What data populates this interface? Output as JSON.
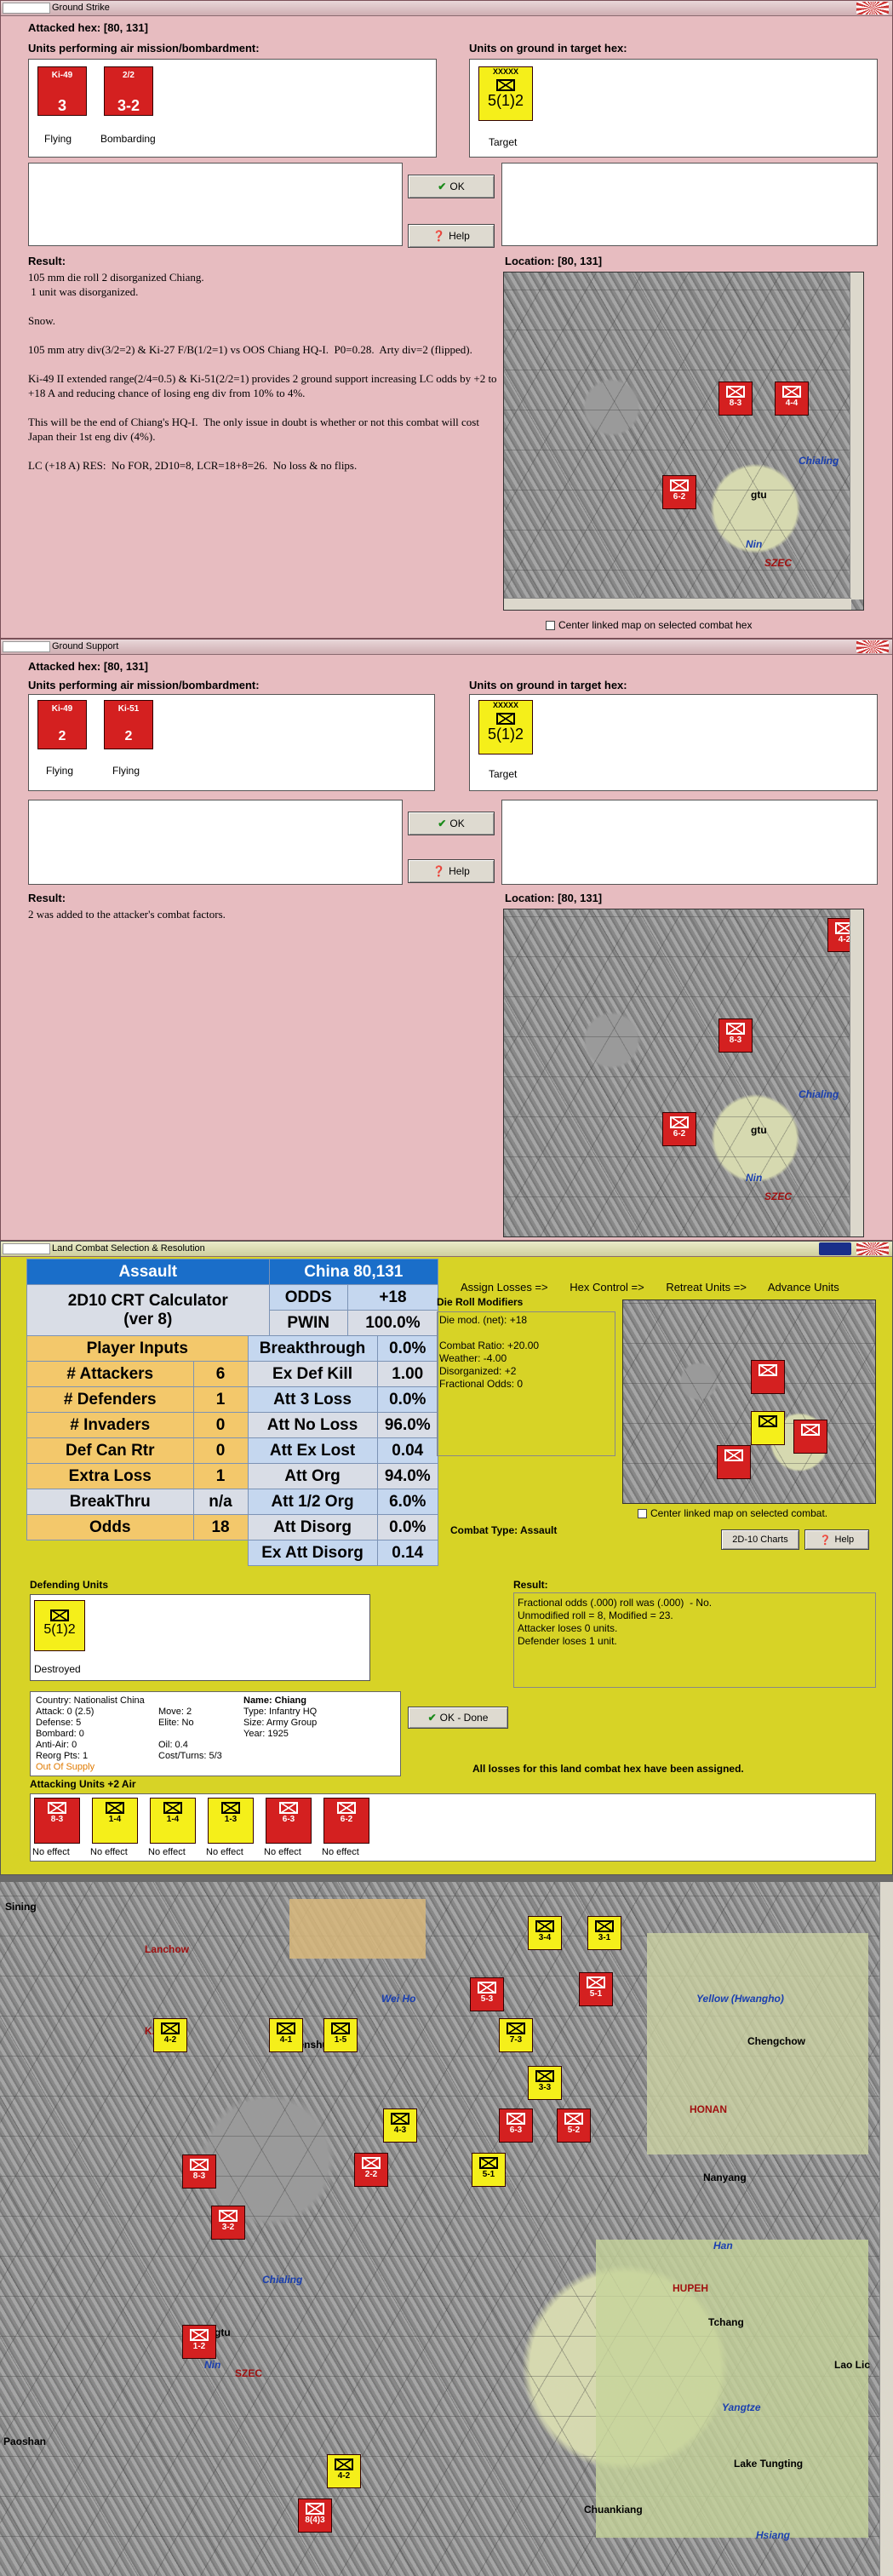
{
  "ground_strike": {
    "title": "Ground Strike",
    "attacked_hex": "Attacked hex:  [80, 131]",
    "units_air_label": "Units performing air mission/bombardment:",
    "units_ground_label": "Units on ground in target hex:",
    "air_units": [
      {
        "name": "Ki-49",
        "value": "3",
        "caption": "Flying"
      },
      {
        "name": "2/2",
        "value": "3-2",
        "caption": "Bombarding"
      }
    ],
    "target_unit": {
      "type": "XXXXX",
      "nation": "Chiang",
      "value": "5(1)2",
      "caption": "Target"
    },
    "ok_label": "OK",
    "help_label": "Help",
    "result_label": "Result:",
    "location_label": "Location:  [80, 131]",
    "result_text": "105 mm die roll 2 disorganized Chiang.\n 1 unit was disorganized.\n\nSnow.\n\n105 mm atry div(3/2=2) & Ki-27 F/B(1/2=1) vs OOS Chiang HQ-I.  P0=0.28.  Arty div=2 (flipped).\n\nKi-49 II extended range(2/4=0.5) & Ki-51(2/2=1) provides 2 ground support increasing LC odds by +2 to +18 A and reducing chance of losing eng div from 10% to 4%.\n\nThis will be the end of Chiang's HQ-I.  The only issue in doubt is whether or not this combat will cost Japan their 1st eng div (4%).\n\nLC (+18 A) RES:  No FOR, 2D10=8, LCR=18+8=26.  No loss & no flips.",
    "center_map_label": "Center linked map on selected combat hex",
    "map_labels": [
      "Chialing",
      "Nin",
      "SZEC",
      "gtu"
    ],
    "map_units": [
      "8-3",
      "4-4",
      "6-2"
    ]
  },
  "ground_support": {
    "title": "Ground Support",
    "attacked_hex": "Attacked hex:  [80, 131]",
    "units_air_label": "Units performing air mission/bombardment:",
    "units_ground_label": "Units on ground in target hex:",
    "air_units": [
      {
        "name": "Ki-49",
        "value": "2",
        "caption": "Flying"
      },
      {
        "name": "Ki-51",
        "value": "2",
        "caption": "Flying"
      }
    ],
    "target_unit": {
      "type": "XXXXX",
      "nation": "Chiang",
      "value": "5(1)2",
      "caption": "Target"
    },
    "ok_label": "OK",
    "help_label": "Help",
    "result_label": "Result:",
    "location_label": "Location:  [80, 131]",
    "result_text": "2 was added to the attacker's combat factors.",
    "map_labels": [
      "Chialing",
      "Nin",
      "SZEC",
      "gtu"
    ],
    "map_units": [
      "8-3",
      "6-2",
      "4-2"
    ]
  },
  "land_combat": {
    "title": "Land Combat Selection & Resolution",
    "tabs": [
      "Assign Losses =>",
      "Hex Control =>",
      "Retreat Units =>",
      "Advance Units"
    ],
    "crt": {
      "assault": "Assault",
      "location": "China 80,131",
      "calc_title": "2D10 CRT Calculator",
      "version": "(ver 8)",
      "player_inputs": "Player Inputs",
      "rows": [
        {
          "label": "# Attackers",
          "value": "6",
          "stat": "Ex Def Kill",
          "pct": "1.00"
        },
        {
          "label": "# Defenders",
          "value": "1",
          "stat": "Att 3 Loss",
          "pct": "0.0%"
        },
        {
          "label": "# Invaders",
          "value": "0",
          "stat": "Att No Loss",
          "pct": "96.0%"
        },
        {
          "label": "Def Can Rtr",
          "value": "0",
          "stat": "Att Ex Lost",
          "pct": "0.04"
        },
        {
          "label": "Extra Loss",
          "value": "1",
          "stat": "Att Org",
          "pct": "94.0%"
        },
        {
          "label": "BreakThru",
          "value": "n/a",
          "stat": "Att 1/2 Org",
          "pct": "6.0%"
        },
        {
          "label": "Odds",
          "value": "18",
          "stat": "Att Disorg",
          "pct": "0.0%"
        }
      ],
      "odds_label": "ODDS",
      "odds_value": "+18",
      "pwin_label": "PWIN",
      "pwin_value": "100.0%",
      "breakthrough_label": "Breakthrough",
      "breakthrough_value": "0.0%",
      "ex_att_label": "Ex Att Disorg",
      "ex_att_value": "0.14"
    },
    "die_roll_title": "Die Roll Modifiers",
    "die_roll_text": "Die mod. (net): +18\n\nCombat Ratio: +20.00\nWeather: -4.00\nDisorganized: +2\nFractional Odds: 0",
    "combat_type": "Combat Type:  Assault",
    "center_map_label": "Center linked map on selected combat.",
    "charts_label": "2D-10 Charts",
    "help_label": "Help",
    "defending_label": "Defending Units",
    "defender": {
      "value": "5(1)2",
      "caption": "Destroyed"
    },
    "result_label": "Result:",
    "result_text": "Fractional odds (.000) roll was (.000)  - No.\nUnmodified roll = 8, Modified = 23.\nAttacker loses 0 units.\nDefender loses 1 unit.",
    "unit_info": {
      "country": "Country: Nationalist China",
      "attack": "Attack: 0 (2.5)",
      "defense": "Defense: 5",
      "bombard": "Bombard: 0",
      "antiair": "Anti-Air: 0",
      "reorg": "Reorg Pts: 1",
      "supply": "Out Of Supply",
      "move": "Move: 2",
      "elite": "Elite: No",
      "oil": "Oil: 0.4",
      "cost": "Cost/Turns: 5/3",
      "name": "Name: Chiang",
      "type": "Type: Infantry HQ",
      "size": "Size: Army Group",
      "year": "Year: 1925"
    },
    "ok_done_label": "OK - Done",
    "all_losses": "All losses for this land combat hex have been assigned.",
    "attacking_label": "Attacking Units +2 Air",
    "attackers": [
      {
        "value": "8-3",
        "caption": "No effect"
      },
      {
        "value": "1-4",
        "caption": "No effect"
      },
      {
        "value": "1-4",
        "caption": "No effect"
      },
      {
        "value": "1-3",
        "caption": "No effect"
      },
      {
        "value": "6-3",
        "caption": "No effect"
      },
      {
        "value": "6-2",
        "caption": "No effect"
      }
    ]
  },
  "big_map": {
    "labels": [
      "Sining",
      "Lanchow",
      "KANSU",
      "Tienshui",
      "Wei Ho",
      "Yellow (Hwangho)",
      "Chengchow",
      "HONAN",
      "Nanyang",
      "Han",
      "HUPEH",
      "Tchang",
      "Chialing",
      "Nin",
      "SZEC",
      "Yangtze",
      "Lake Tungting",
      "Chuankiang",
      "Hsiang",
      "Paoshan",
      "Lao Lic",
      "gtu"
    ],
    "units": [
      "3-4",
      "3-1",
      "4-2",
      "4-1",
      "1-5",
      "7-3",
      "5-3",
      "4-3",
      "6-3",
      "5-2",
      "3-3",
      "2-2",
      "3-2",
      "5-1",
      "8-3",
      "1-2",
      "4-2",
      "8(4)3",
      "5-1"
    ]
  }
}
